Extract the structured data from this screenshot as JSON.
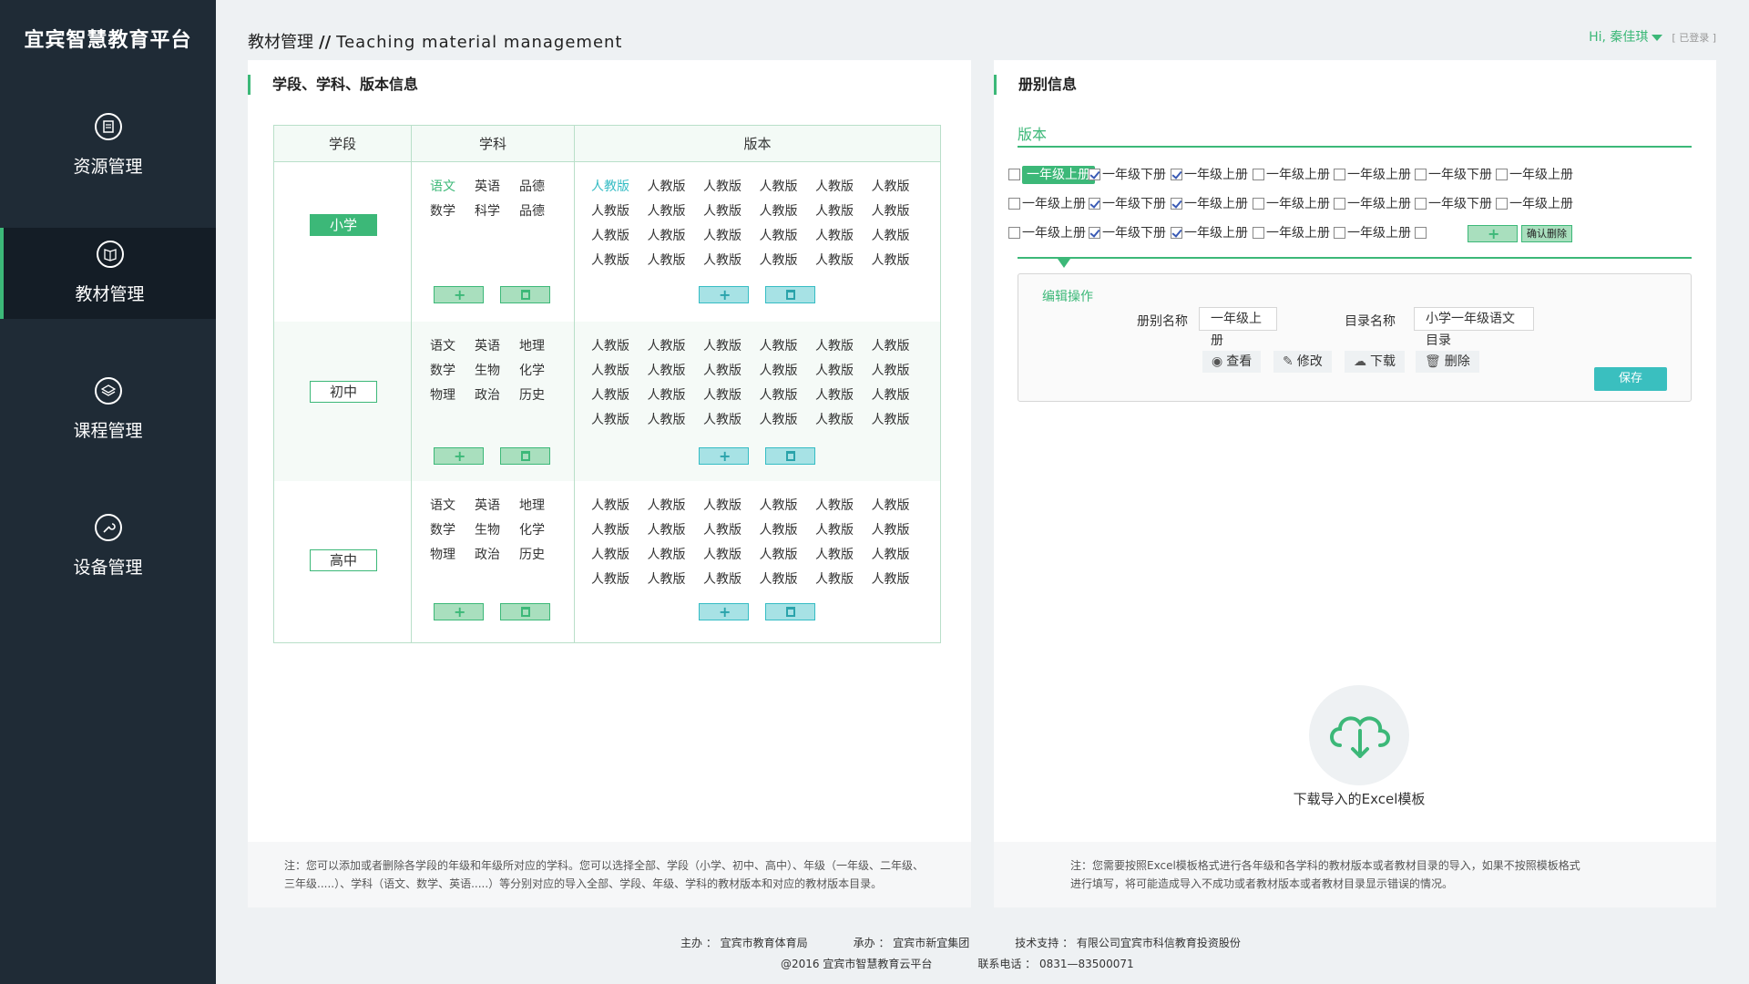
{
  "app": {
    "logo": "宜宾智慧教育平台"
  },
  "sidebar": {
    "items": [
      {
        "label": "资源管理",
        "icon": "resource-icon"
      },
      {
        "label": "教材管理",
        "icon": "book-icon"
      },
      {
        "label": "课程管理",
        "icon": "layers-icon"
      },
      {
        "label": "设备管理",
        "icon": "wrench-icon"
      }
    ],
    "active_index": 1
  },
  "header": {
    "title_cn": "教材管理",
    "separator": "//",
    "title_en": "Teaching material management",
    "user": "Hi, 秦佳琪",
    "login_status": "[ 已登录 ]"
  },
  "left_panel": {
    "heading": "学段、学科、版本信息",
    "columns": [
      "学段",
      "学科",
      "版本"
    ],
    "rows": [
      {
        "stage": "小学",
        "subjects": [
          "语文",
          "英语",
          "品德",
          "数学",
          "科学",
          "品德"
        ],
        "versions": [
          "人教版",
          "人教版",
          "人教版",
          "人教版",
          "人教版",
          "人教版",
          "人教版",
          "人教版",
          "人教版",
          "人教版",
          "人教版",
          "人教版",
          "人教版",
          "人教版",
          "人教版",
          "人教版",
          "人教版",
          "人教版",
          "人教版",
          "人教版",
          "人教版",
          "人教版",
          "人教版",
          "人教版"
        ]
      },
      {
        "stage": "初中",
        "subjects": [
          "语文",
          "英语",
          "地理",
          "数学",
          "生物",
          "化学",
          "物理",
          "政治",
          "历史"
        ],
        "versions": [
          "人教版",
          "人教版",
          "人教版",
          "人教版",
          "人教版",
          "人教版",
          "人教版",
          "人教版",
          "人教版",
          "人教版",
          "人教版",
          "人教版",
          "人教版",
          "人教版",
          "人教版",
          "人教版",
          "人教版",
          "人教版",
          "人教版",
          "人教版",
          "人教版",
          "人教版",
          "人教版",
          "人教版"
        ]
      },
      {
        "stage": "高中",
        "subjects": [
          "语文",
          "英语",
          "地理",
          "数学",
          "生物",
          "化学",
          "物理",
          "政治",
          "历史"
        ],
        "versions": [
          "人教版",
          "人教版",
          "人教版",
          "人教版",
          "人教版",
          "人教版",
          "人教版",
          "人教版",
          "人教版",
          "人教版",
          "人教版",
          "人教版",
          "人教版",
          "人教版",
          "人教版",
          "人教版",
          "人教版",
          "人教版",
          "人教版",
          "人教版",
          "人教版",
          "人教版",
          "人教版",
          "人教版"
        ]
      }
    ],
    "note_line1": "注：您可以添加或者删除各学段的年级和年级所对应的学科。您可以选择全部、学段（小学、初中、高中）、年级（一年级、二年级、",
    "note_line2": "三年级.....）、学科（语文、数学、英语.....）等分别对应的导入全部、学段、年级、学科的教材版本和对应的教材版本目录。"
  },
  "right_panel": {
    "heading": "册别信息",
    "version_label": "版本",
    "volumes": [
      [
        {
          "label": "一年级上册",
          "checked": false,
          "selected": true
        },
        {
          "label": "一年级下册",
          "checked": true
        },
        {
          "label": "一年级上册",
          "checked": true
        },
        {
          "label": "一年级上册",
          "checked": false
        },
        {
          "label": "一年级上册",
          "checked": false
        },
        {
          "label": "一年级下册",
          "checked": false
        },
        {
          "label": "一年级上册",
          "checked": false
        }
      ],
      [
        {
          "label": "一年级上册",
          "checked": false
        },
        {
          "label": "一年级下册",
          "checked": true
        },
        {
          "label": "一年级上册",
          "checked": true
        },
        {
          "label": "一年级上册",
          "checked": false
        },
        {
          "label": "一年级上册",
          "checked": false
        },
        {
          "label": "一年级下册",
          "checked": false
        },
        {
          "label": "一年级上册",
          "checked": false
        }
      ],
      [
        {
          "label": "一年级上册",
          "checked": false
        },
        {
          "label": "一年级下册",
          "checked": true
        },
        {
          "label": "一年级上册",
          "checked": true
        },
        {
          "label": "一年级上册",
          "checked": false
        },
        {
          "label": "一年级上册",
          "checked": false
        },
        {
          "label": "",
          "checked": false
        }
      ]
    ],
    "confirm_delete": "确认删除",
    "edit": {
      "title": "编辑操作",
      "volume_name_label": "册别名称",
      "volume_name_value": "一年级上册",
      "catalog_label": "目录名称",
      "catalog_value": "小学一年级语文目录",
      "actions": [
        "查看",
        "修改",
        "下载",
        "删除"
      ],
      "save": "保存"
    },
    "download_label": "下载导入的Excel模板",
    "note_line1": "注：您需要按照Excel模板格式进行各年级和各学科的教材版本或者教材目录的导入，如果不按照模板格式",
    "note_line2": "进行填写，将可能造成导入不成功或者教材版本或者教材目录显示错误的情况。"
  },
  "footer": {
    "host": "主办 ： 宜宾市教育体育局",
    "organizer": "承办 ： 宜宾市新宜集团",
    "support": "技术支持 ： 有限公司宜宾市科信教育投资股份",
    "copyright": "@2016   宜宾市智慧教育云平台",
    "phone": "联系电话 ： 0831—83500071"
  },
  "colors": {
    "accent": "#3cb878",
    "teal": "#35bcc4",
    "sidebar": "#1f2b36"
  }
}
